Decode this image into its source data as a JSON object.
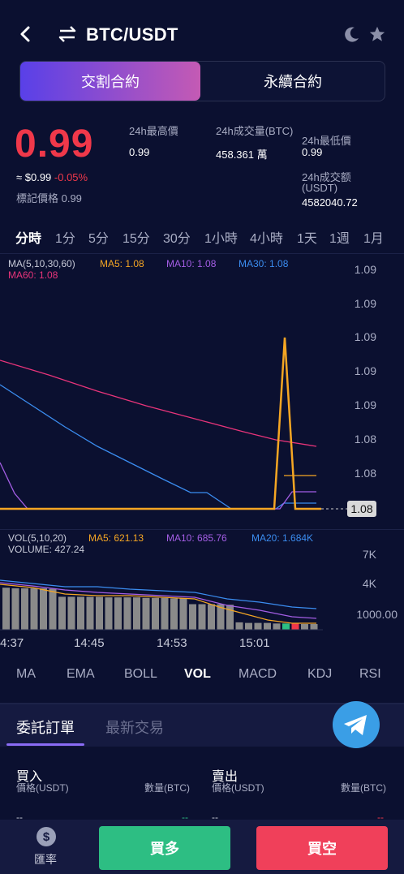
{
  "header": {
    "pair": "BTC/USDT",
    "back_icon": "chevron-left-icon",
    "swap_icon": "swap-icon",
    "theme_icon": "moon-icon",
    "favorite_icon": "star-icon"
  },
  "segment": {
    "active_label": "交割合約",
    "inactive_label": "永續合約"
  },
  "ticker": {
    "price": "0.99",
    "approx": "≈ $0.99",
    "change": "-0.05%",
    "mark_price": "標記價格 0.99",
    "high_label": "24h最高價",
    "high_value": "0.99",
    "volume_label": "24h成交量(BTC)",
    "volume_value": "458.361 萬",
    "low_label": "24h最低價",
    "low_value": "0.99",
    "amount_label": "24h成交额",
    "amount_label2": "(USDT)",
    "amount_value": "4582040.72"
  },
  "period_tabs": [
    "分時",
    "1分",
    "5分",
    "15分",
    "30分",
    "1小時",
    "4小時",
    "1天",
    "1週",
    "1月"
  ],
  "period_active": "分時",
  "ma_legend": {
    "title": "MA(5,10,30,60)",
    "ma5": "MA5: 1.08",
    "ma10": "MA10: 1.08",
    "ma30": "MA30: 1.08",
    "ma60": "MA60: 1.08"
  },
  "price_axis": [
    "1.09",
    "1.09",
    "1.09",
    "1.09",
    "1.09",
    "1.08",
    "1.08"
  ],
  "current_price_tag": "1.08",
  "vol_legend": {
    "title": "VOL(5,10,20)",
    "ma5": "MA5: 621.13",
    "ma10": "MA10: 685.76",
    "ma20": "MA20: 1.684K",
    "volume": "VOLUME: 427.24"
  },
  "vol_axis": [
    "7K",
    "4K",
    "1000.00"
  ],
  "time_axis": [
    "4:37",
    "14:45",
    "14:53",
    "15:01"
  ],
  "indicator_tabs": [
    "MA",
    "EMA",
    "BOLL",
    "VOL",
    "MACD",
    "KDJ",
    "RSI"
  ],
  "indicator_active": "VOL",
  "orderbook": {
    "tab_active": "委託訂單",
    "tab_inactive": "最新交易",
    "buy_title": "買入",
    "sell_title": "賣出",
    "buy_price_label": "價格(USDT)",
    "buy_qty_label": "數量(BTC)",
    "sell_price_label": "價格(USDT)",
    "sell_qty_label": "數量(BTC)",
    "dash": "--"
  },
  "bottom": {
    "rate_label": "匯率",
    "rate_icon": "dollar-coin-icon",
    "buy_label": "買多",
    "sell_label": "買空"
  },
  "colors": {
    "background": "#0b1030",
    "up": "#2dbe83",
    "down": "#f0384a",
    "ma5": "#f5a623",
    "ma10": "#a45ee5",
    "ma30": "#3b8df0",
    "ma60": "#e8347a"
  },
  "chart_data": {
    "type": "line",
    "series": [
      {
        "name": "MA5",
        "values": [
          1.08,
          1.08,
          1.08,
          1.08,
          1.08,
          1.08,
          1.08,
          1.08,
          1.08,
          1.08,
          1.09,
          1.08,
          1.08
        ]
      },
      {
        "name": "MA60",
        "values": [
          1.09,
          1.09,
          1.09,
          1.09,
          1.09,
          1.08,
          1.08,
          1.08,
          1.08,
          1.08,
          1.08,
          1.08,
          1.08
        ]
      },
      {
        "name": "MA30",
        "values": [
          1.09,
          1.09,
          1.09,
          1.08,
          1.08,
          1.08,
          1.08,
          1.08,
          1.08,
          1.08,
          1.08,
          1.08,
          1.08
        ]
      },
      {
        "name": "MA10",
        "values": [
          1.08,
          1.08,
          1.08,
          1.08,
          1.08,
          1.08,
          1.08,
          1.08,
          1.08,
          1.08,
          1.08,
          1.08,
          1.08
        ]
      }
    ],
    "volume": {
      "type": "bar",
      "values": [
        7400,
        7300,
        7300,
        7300,
        7300,
        7200,
        5800,
        5800,
        5800,
        5800,
        5800,
        5700,
        5700,
        5700,
        5700,
        5600,
        5600,
        5600,
        5500,
        5500,
        4500,
        4500,
        4500,
        4500,
        4400,
        1300,
        1200,
        1200,
        1200,
        1100,
        1100,
        1100,
        1000,
        1000
      ]
    },
    "x_ticks": [
      "4:37",
      "14:45",
      "14:53",
      "15:01"
    ],
    "grid": false
  }
}
